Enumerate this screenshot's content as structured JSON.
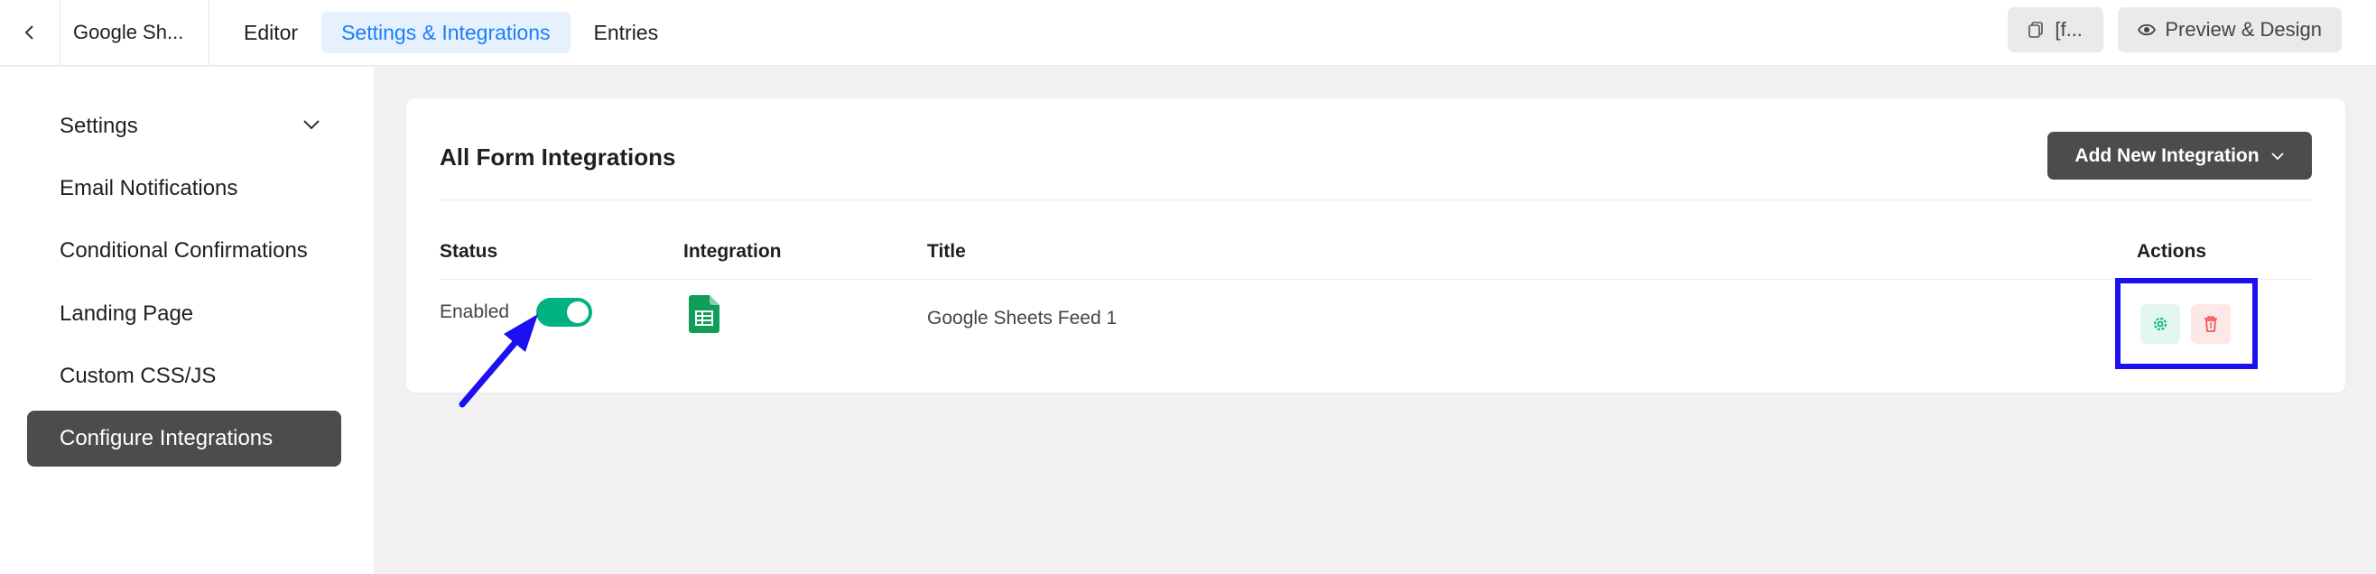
{
  "topbar": {
    "form_name": "Google Sh...",
    "tabs": [
      {
        "label": "Editor"
      },
      {
        "label": "Settings & Integrations"
      },
      {
        "label": "Entries"
      }
    ],
    "shortcode_label": "[f...",
    "preview_label": "Preview & Design"
  },
  "sidebar": {
    "items": [
      {
        "label": "Settings"
      },
      {
        "label": "Email Notifications"
      },
      {
        "label": "Conditional Confirmations"
      },
      {
        "label": "Landing Page"
      },
      {
        "label": "Custom CSS/JS"
      },
      {
        "label": "Configure Integrations"
      }
    ]
  },
  "main": {
    "title": "All Form Integrations",
    "add_button_label": "Add New Integration",
    "columns": {
      "status": "Status",
      "integration": "Integration",
      "title": "Title",
      "actions": "Actions"
    },
    "rows": [
      {
        "status_text": "Enabled",
        "enabled": true,
        "integration_icon": "google-sheets-icon",
        "title": "Google Sheets Feed 1"
      }
    ]
  },
  "colors": {
    "accent": "#1a7efb",
    "toggle_on": "#00b27f",
    "annotation": "#1a10f0",
    "active_sidebar": "#4b4c4d"
  }
}
